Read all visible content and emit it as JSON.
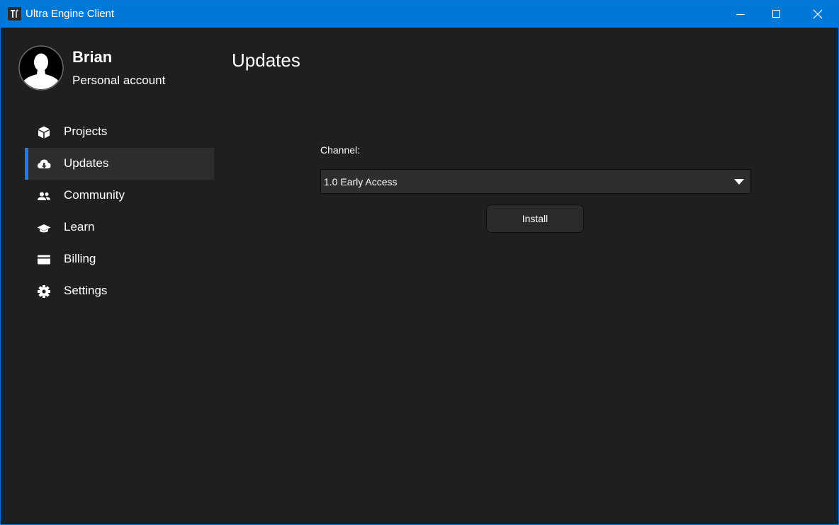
{
  "window": {
    "title": "Ultra Engine Client",
    "app_icon": "ultra-engine-logo-icon",
    "controls": [
      "minimize-icon",
      "maximize-icon",
      "close-icon"
    ],
    "accent_color": "#0078d7"
  },
  "profile": {
    "name": "Brian",
    "account_type": "Personal account",
    "avatar_icon": "user-avatar-icon"
  },
  "sidebar": {
    "items": [
      {
        "label": "Projects",
        "icon": "box-icon",
        "active": false
      },
      {
        "label": "Updates",
        "icon": "cloud-download-icon",
        "active": true
      },
      {
        "label": "Community",
        "icon": "people-icon",
        "active": false
      },
      {
        "label": "Learn",
        "icon": "graduation-cap-icon",
        "active": false
      },
      {
        "label": "Billing",
        "icon": "credit-card-icon",
        "active": false
      },
      {
        "label": "Settings",
        "icon": "gear-icon",
        "active": false
      }
    ],
    "active_color": "#1e7be6"
  },
  "main": {
    "title": "Updates",
    "channel_label": "Channel:",
    "channel_value": "1.0 Early Access",
    "install_label": "Install"
  }
}
